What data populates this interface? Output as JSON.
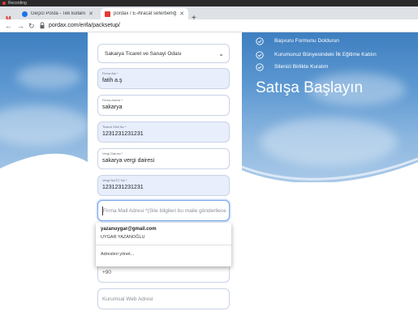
{
  "recording": {
    "label": "Recording"
  },
  "browser": {
    "tabs": [
      {
        "label": "Gelen Kutusu",
        "active": false
      },
      {
        "label": "Geçici Posta - Tek kullanımlık ev...",
        "active": false
      },
      {
        "label": "pordax / E-ihracat seferberliği",
        "active": true
      }
    ],
    "url": "pordax.com/erifa/packsetup/"
  },
  "form": {
    "chamber_select": "Sakarya Ticaret ve Sanayi Odası",
    "fields": [
      {
        "label": "Firma Adı *",
        "value": "fatih a.ş"
      },
      {
        "label": "Firma Adresi *",
        "value": "sakarya"
      },
      {
        "label": "Ticaret Sicil No *",
        "value": "1231231231231"
      },
      {
        "label": "Vergi Dairesi *",
        "value": "sakarya vergi dairesi"
      },
      {
        "label": "Vergi No/TC No *",
        "value": "1231231231231"
      }
    ],
    "email_placeholder": "Firma Mail Adresi *(Site bilgileri bu maile gönderilecek)",
    "phone_value": "+90",
    "website_placeholder": "Kurumsal Web Adresi"
  },
  "autofill": {
    "email": "yazanuygar@gmail.com",
    "name": "UYGAR YAZANOĞLU",
    "manage": "Adresleri yönet..."
  },
  "steps": [
    "Başvuru Formunu Doldurun",
    "Kurumunuz Bünyesindeki İlk Eğitime Katılın",
    "Sitenizi Birlikte Kuralım"
  ],
  "headline": "Satışa Başlayın",
  "colors": {
    "sky": "#5b97d1",
    "field_fill": "#e8eefc",
    "accent": "#7aa7e8"
  }
}
